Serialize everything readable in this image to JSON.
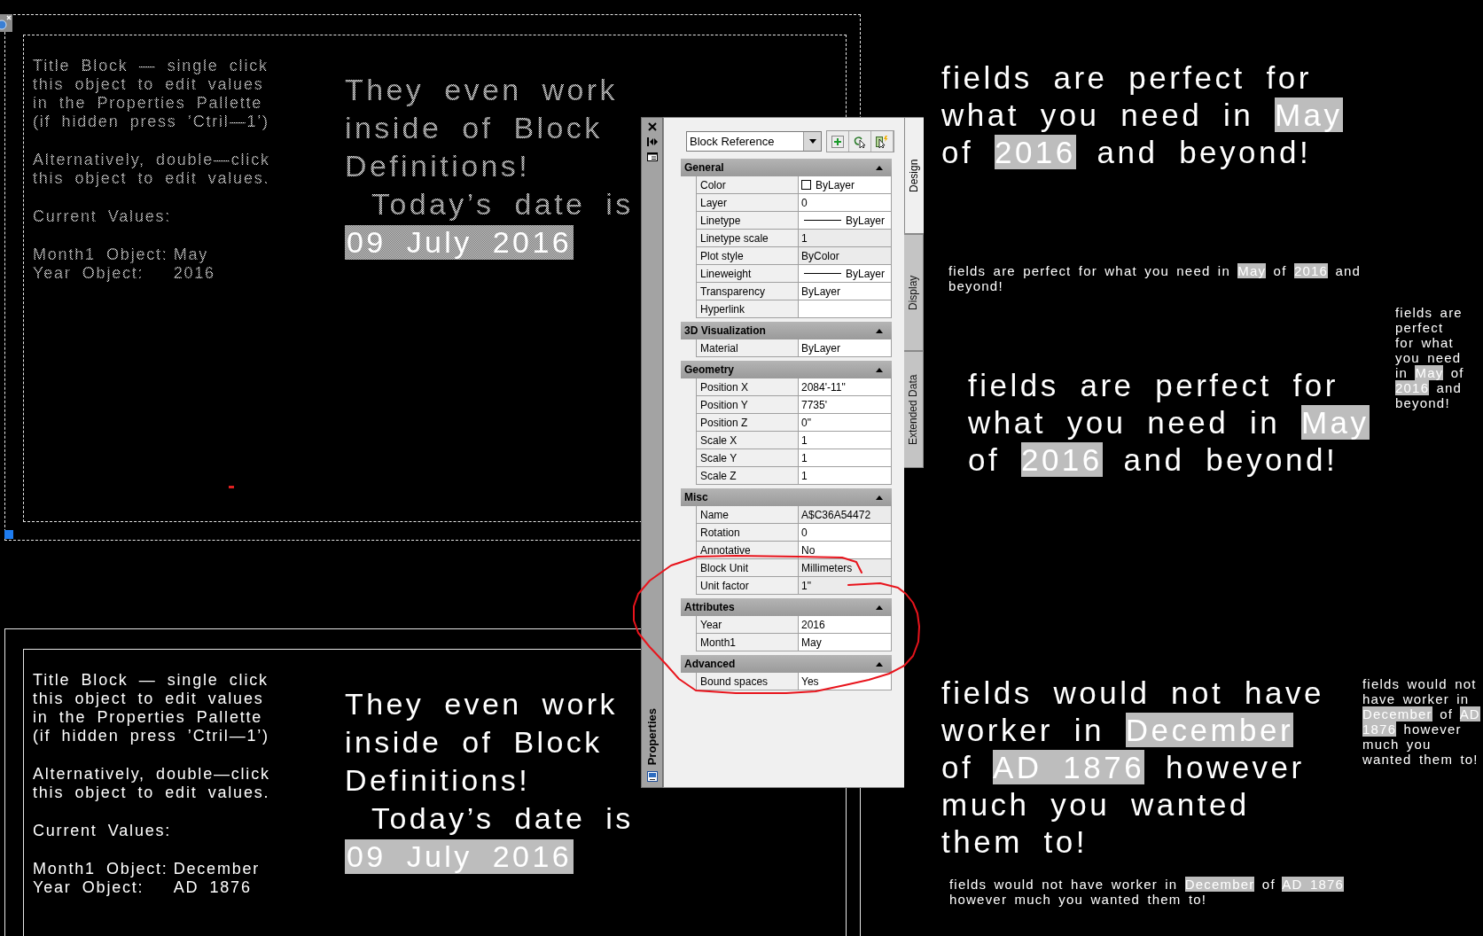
{
  "canvas": {
    "title_blocks": [
      {
        "selected": true,
        "paragraphs": [
          [
            "Title Block — single click",
            "this object to edit values",
            "in the Properties Pallette",
            "(if hidden press ’Ctril—1’)"
          ],
          [
            "Alternatively, double—click",
            "this object to edit values."
          ],
          [
            "Current Values:"
          ]
        ],
        "values": [
          {
            "label": "Month1 Object:",
            "value": "May"
          },
          {
            "label": "Year Object:",
            "value": "2016"
          }
        ],
        "headline": [
          "They even work",
          "inside of Block",
          "Definitions!"
        ],
        "date_label": "Today’s date is",
        "date_field": "09 July 2016"
      },
      {
        "selected": false,
        "paragraphs": [
          [
            "Title Block — single click",
            "this object to edit values",
            "in the Properties Pallette",
            "(if hidden press ’Ctril—1’)"
          ],
          [
            "Alternatively, double—click",
            "this object to edit values."
          ],
          [
            "Current Values:"
          ]
        ],
        "values": [
          {
            "label": "Month1 Object:",
            "value": "December"
          },
          {
            "label": "Year Object:",
            "value": "AD 1876"
          }
        ],
        "headline": [
          "They even work",
          "inside of Block",
          "Definitions!"
        ],
        "date_label": "Today’s date is",
        "date_field": "09 July 2016"
      }
    ],
    "field_texts": [
      {
        "kind": "large",
        "lines": [
          [
            {
              "text": "fields are perfect for",
              "field": false
            }
          ],
          [
            {
              "text": "what you need in ",
              "field": false
            },
            {
              "text": "May",
              "field": true
            }
          ],
          [
            {
              "text": "of ",
              "field": false
            },
            {
              "text": "2016",
              "field": true
            },
            {
              "text": " and beyond!",
              "field": false
            }
          ]
        ]
      },
      {
        "kind": "small",
        "lines": [
          [
            {
              "text": "fields are perfect for what you need in ",
              "field": false
            },
            {
              "text": "May",
              "field": true
            },
            {
              "text": " of ",
              "field": false
            },
            {
              "text": "2016",
              "field": true
            },
            {
              "text": " and",
              "field": false
            }
          ],
          [
            {
              "text": "beyond!",
              "field": false
            }
          ]
        ]
      },
      {
        "kind": "small",
        "lines": [
          [
            {
              "text": "fields are",
              "field": false
            }
          ],
          [
            {
              "text": "perfect",
              "field": false
            }
          ],
          [
            {
              "text": "for what",
              "field": false
            }
          ],
          [
            {
              "text": "you need",
              "field": false
            }
          ],
          [
            {
              "text": "in ",
              "field": false
            },
            {
              "text": "May",
              "field": true
            },
            {
              "text": " of",
              "field": false
            }
          ],
          [
            {
              "text": "2016",
              "field": true
            },
            {
              "text": " and",
              "field": false
            }
          ],
          [
            {
              "text": "beyond!",
              "field": false
            }
          ]
        ]
      },
      {
        "kind": "large",
        "lines": [
          [
            {
              "text": "fields are perfect for",
              "field": false
            }
          ],
          [
            {
              "text": "what you need in ",
              "field": false
            },
            {
              "text": "May",
              "field": true
            }
          ],
          [
            {
              "text": "of ",
              "field": false
            },
            {
              "text": "2016",
              "field": true
            },
            {
              "text": " and beyond!",
              "field": false
            }
          ]
        ]
      },
      {
        "kind": "large",
        "lines": [
          [
            {
              "text": "fields would not have",
              "field": false
            }
          ],
          [
            {
              "text": "worker in ",
              "field": false
            },
            {
              "text": "December",
              "field": true
            }
          ],
          [
            {
              "text": "of ",
              "field": false
            },
            {
              "text": "AD 1876",
              "field": true
            },
            {
              "text": " however",
              "field": false
            }
          ],
          [
            {
              "text": "much you wanted",
              "field": false
            }
          ],
          [
            {
              "text": "them to!",
              "field": false
            }
          ]
        ]
      },
      {
        "kind": "small",
        "lines": [
          [
            {
              "text": "fields would not have worker in ",
              "field": false
            },
            {
              "text": "December",
              "field": true
            },
            {
              "text": " of ",
              "field": false
            },
            {
              "text": "AD 1876",
              "field": true
            }
          ],
          [
            {
              "text": "however much you wanted them to!",
              "field": false
            }
          ]
        ]
      },
      {
        "kind": "small",
        "lines": [
          [
            {
              "text": "fields would not",
              "field": false
            }
          ],
          [
            {
              "text": "have worker in",
              "field": false
            }
          ],
          [
            {
              "text": "December",
              "field": true
            },
            {
              "text": " of ",
              "field": false
            },
            {
              "text": "AD",
              "field": true
            }
          ],
          [
            {
              "text": "1876",
              "field": true
            },
            {
              "text": " however",
              "field": false
            }
          ],
          [
            {
              "text": "much you",
              "field": false
            }
          ],
          [
            {
              "text": "wanted them to!",
              "field": false
            }
          ]
        ]
      }
    ]
  },
  "properties_palette": {
    "title": "Properties",
    "object_type": "Block Reference",
    "tabs": [
      {
        "label": "Design",
        "selected": true
      },
      {
        "label": "Display",
        "selected": false
      },
      {
        "label": "Extended Data",
        "selected": false
      }
    ],
    "sections": [
      {
        "title": "General",
        "expanded": true,
        "rows": [
          {
            "name": "Color",
            "value": "ByLayer",
            "kind": "color",
            "readonly": false
          },
          {
            "name": "Layer",
            "value": "0",
            "kind": "text",
            "readonly": false
          },
          {
            "name": "Linetype",
            "value": "ByLayer",
            "kind": "line",
            "readonly": false
          },
          {
            "name": "Linetype scale",
            "value": "1",
            "kind": "text",
            "readonly": true
          },
          {
            "name": "Plot style",
            "value": "ByColor",
            "kind": "text",
            "readonly": true
          },
          {
            "name": "Lineweight",
            "value": "ByLayer",
            "kind": "line",
            "readonly": false
          },
          {
            "name": "Transparency",
            "value": "ByLayer",
            "kind": "text",
            "readonly": false
          },
          {
            "name": "Hyperlink",
            "kind": "text",
            "readonly": false
          }
        ]
      },
      {
        "title": "3D Visualization",
        "expanded": true,
        "rows": [
          {
            "name": "Material",
            "value": "ByLayer",
            "kind": "text",
            "readonly": false
          }
        ]
      },
      {
        "title": "Geometry",
        "expanded": true,
        "rows": [
          {
            "name": "Position X",
            "value": "2084'-11\"",
            "kind": "text",
            "readonly": false
          },
          {
            "name": "Position Y",
            "value": "7735'",
            "kind": "text",
            "readonly": false
          },
          {
            "name": "Position Z",
            "value": "0\"",
            "kind": "text",
            "readonly": false
          },
          {
            "name": "Scale X",
            "value": "1",
            "kind": "text",
            "readonly": false
          },
          {
            "name": "Scale Y",
            "value": "1",
            "kind": "text",
            "readonly": false
          },
          {
            "name": "Scale Z",
            "value": "1",
            "kind": "text",
            "readonly": false
          }
        ]
      },
      {
        "title": "Misc",
        "expanded": true,
        "rows": [
          {
            "name": "Name",
            "value": "A$C36A54472",
            "kind": "text",
            "readonly": true
          },
          {
            "name": "Rotation",
            "value": "0",
            "kind": "text",
            "readonly": false
          },
          {
            "name": "Annotative",
            "value": "No",
            "kind": "text",
            "readonly": false
          },
          {
            "name": "Block Unit",
            "value": "Millimeters",
            "kind": "text",
            "readonly": true
          },
          {
            "name": "Unit factor",
            "value": "1\"",
            "kind": "text",
            "readonly": true
          }
        ]
      },
      {
        "title": "Attributes",
        "expanded": true,
        "rows": [
          {
            "name": "Year",
            "value": "2016",
            "kind": "text",
            "readonly": false
          },
          {
            "name": "Month1",
            "value": "May",
            "kind": "text",
            "readonly": false
          }
        ]
      },
      {
        "title": "Advanced",
        "expanded": true,
        "rows": [
          {
            "name": "Bound spaces",
            "value": "Yes",
            "kind": "text",
            "readonly": false
          }
        ]
      }
    ]
  }
}
